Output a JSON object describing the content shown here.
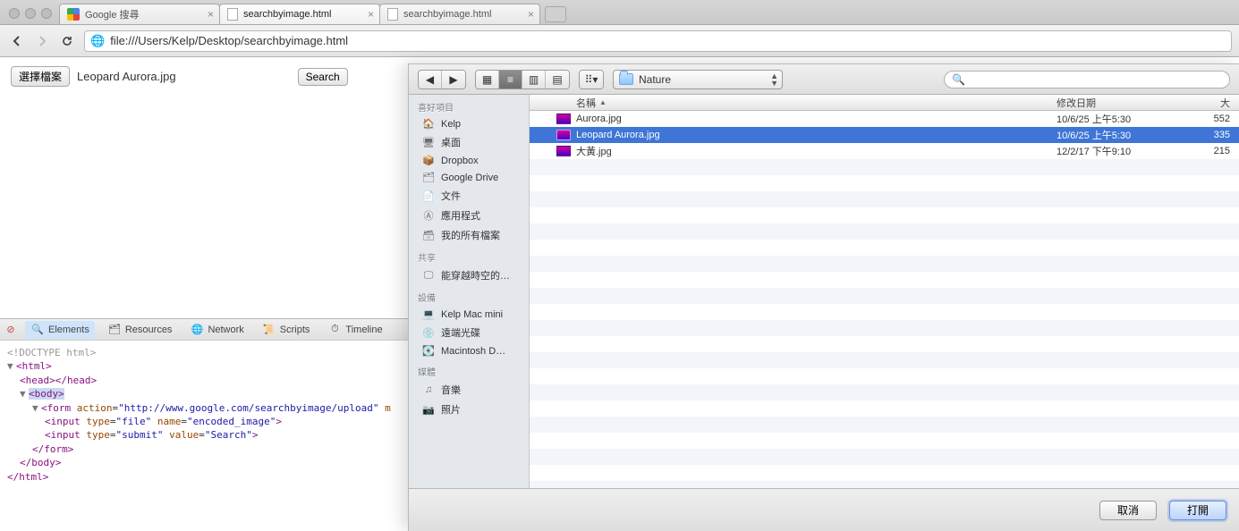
{
  "browser": {
    "tabs": [
      {
        "title": "Google 搜尋",
        "icon": "google"
      },
      {
        "title": "searchbyimage.html",
        "icon": "file",
        "active": true
      },
      {
        "title": "searchbyimage.html",
        "icon": "file"
      }
    ],
    "url": "file:///Users/Kelp/Desktop/searchbyimage.html"
  },
  "page": {
    "choose_label": "選擇檔案",
    "chosen_file": "Leopard Aurora.jpg",
    "submit_label": "Search"
  },
  "devtools": {
    "tabs": [
      "Elements",
      "Resources",
      "Network",
      "Scripts",
      "Timeline"
    ],
    "active_tab": "Elements",
    "doctype": "<!DOCTYPE html>",
    "form_action": "http://www.google.com/searchbyimage/upload",
    "input1": {
      "type": "file",
      "name": "encoded_image"
    },
    "input2": {
      "type": "submit",
      "value": "Search"
    }
  },
  "dialog": {
    "folder": "Nature",
    "search_placeholder": "",
    "columns": {
      "name": "名稱",
      "date": "修改日期",
      "size": "大"
    },
    "sidebar": {
      "favorites_label": "喜好項目",
      "favorites": [
        {
          "icon": "home",
          "label": "Kelp"
        },
        {
          "icon": "desktop",
          "label": "桌面"
        },
        {
          "icon": "box",
          "label": "Dropbox"
        },
        {
          "icon": "drive",
          "label": "Google Drive"
        },
        {
          "icon": "doc",
          "label": "文件"
        },
        {
          "icon": "app",
          "label": "應用程式"
        },
        {
          "icon": "files",
          "label": "我的所有檔案"
        }
      ],
      "shared_label": "共享",
      "shared": [
        {
          "icon": "screen",
          "label": "能穿越時空的…"
        }
      ],
      "devices_label": "設備",
      "devices": [
        {
          "icon": "mac",
          "label": "Kelp Mac mini"
        },
        {
          "icon": "disc",
          "label": "遠端光碟"
        },
        {
          "icon": "hdd",
          "label": "Macintosh D…"
        }
      ],
      "media_label": "媒體",
      "media": [
        {
          "icon": "music",
          "label": "音樂"
        },
        {
          "icon": "photo",
          "label": "照片"
        }
      ]
    },
    "files": [
      {
        "name": "Aurora.jpg",
        "date": "10/6/25 上午5:30",
        "size": "552",
        "selected": false
      },
      {
        "name": "Leopard Aurora.jpg",
        "date": "10/6/25 上午5:30",
        "size": "335",
        "selected": true
      },
      {
        "name": "大黃.jpg",
        "date": "12/2/17 下午9:10",
        "size": "215",
        "selected": false
      }
    ],
    "buttons": {
      "cancel": "取消",
      "open": "打開"
    }
  }
}
